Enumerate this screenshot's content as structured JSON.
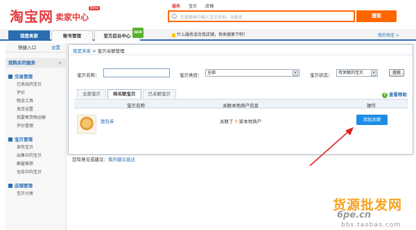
{
  "header": {
    "logo": "淘宝网",
    "logo_sub": "卖家中心",
    "logo_badge": "Beta",
    "search_tabs": [
      "服务",
      "宝贝",
      "店铺"
    ],
    "search_placeholder": "在搜索框中输入宝贝名称，功能名",
    "search_button": "搜索"
  },
  "nav": {
    "tabs": [
      "我是卖家",
      "账号管理",
      "官方后台中心"
    ],
    "new_badge": "NEW",
    "tip": "什么服务适合我店铺，快来搜索下吧！",
    "my_taobao": "我的淘宝 >"
  },
  "sidebar": {
    "quick_entry": "快捷入口",
    "settings": "设置",
    "my_bought_service": "我购买的服务",
    "sections": [
      {
        "title": "交易管理",
        "items": [
          "已卖出的宝贝",
          "评价",
          "物流工具",
          "发货设置",
          "我要寄货物运输",
          "评价管理"
        ]
      },
      {
        "title": "宝贝管理",
        "items": [
          "发布宝贝",
          "出售中的宝贝",
          "橱窗推荐",
          "仓库中的宝贝"
        ]
      },
      {
        "title": "店铺管理",
        "items": [
          "宝贝分类"
        ]
      }
    ]
  },
  "panel": {
    "breadcrumb_home": "我是卖家",
    "breadcrumb_sep": " > ",
    "breadcrumb_current": "宝贝关联管理",
    "filter_name_label": "宝贝名称：",
    "filter_name_value": "",
    "filter_category_label": "宝贝类目：",
    "filter_category_value": "全部",
    "filter_status_label": "宝贝状态：",
    "filter_status_value": "待关联的宝贝",
    "search_button": "搜索",
    "tabs": [
      "全部宝贝",
      "待关联宝贝",
      "已关联宝贝"
    ],
    "help": "查看帮助",
    "columns": [
      "宝贝名称",
      "关联本地商户信息",
      "操作"
    ],
    "rows": [
      {
        "name": "面包券",
        "linked_prefix": "关联了",
        "linked_count": "0",
        "linked_suffix": "家本地商户",
        "action": "添加关联"
      }
    ]
  },
  "below_panel": {
    "prefix": "您有意见或建议：",
    "link": "我的建议直达"
  },
  "watermark": {
    "line1": "货源批发网",
    "line2": "6pe.cn",
    "line3": "bbs.taobao.com"
  }
}
